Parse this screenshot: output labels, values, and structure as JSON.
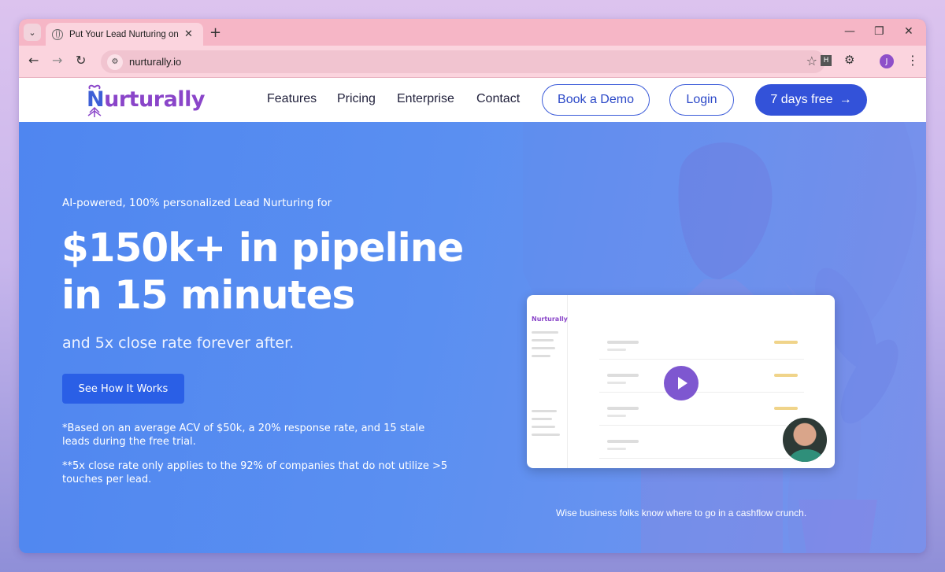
{
  "browser": {
    "tab_title": "Put Your Lead Nurturing on Aut",
    "url": "nurturally.io",
    "profile_initial": "J",
    "extension_label": "H",
    "icons": {
      "tab_search": "chevron-down-icon",
      "favicon": "globe-icon",
      "tab_close": "close-icon",
      "new_tab": "plus-icon",
      "minimize": "minimize-icon",
      "restore": "restore-icon",
      "close_window": "close-icon",
      "back": "arrow-left-icon",
      "forward": "arrow-right-icon",
      "reload": "reload-icon",
      "site_info": "tune-icon",
      "bookmark": "star-icon",
      "extensions": "puzzle-icon",
      "menu": "kebab-icon"
    }
  },
  "site": {
    "logo_text": "Nurturally",
    "nav": {
      "features": "Features",
      "pricing": "Pricing",
      "enterprise": "Enterprise",
      "contact": "Contact"
    },
    "book_demo": "Book a Demo",
    "login": "Login",
    "trial": "7 days free",
    "colors": {
      "brand_purple": "#8a45c9",
      "brand_blue": "#3352d9",
      "hero_bg": "#5a8ff1"
    }
  },
  "hero": {
    "eyebrow": "AI-powered, 100% personalized Lead Nurturing for",
    "headline_line1": "$150k+ in pipeline",
    "headline_line2": "in 15 minutes",
    "subhead": "and 5x close rate forever after.",
    "cta": "See How It Works",
    "footnote1": "*Based on an average ACV of $50k, a 20% response rate, and 15 stale leads during the free trial.",
    "footnote2": "**5x close rate only applies to the 92% of companies that do not utilize >5 touches per lead.",
    "video_caption": "Wise business folks know where to go in a cashflow crunch.",
    "video_logo": "Nurturally"
  }
}
